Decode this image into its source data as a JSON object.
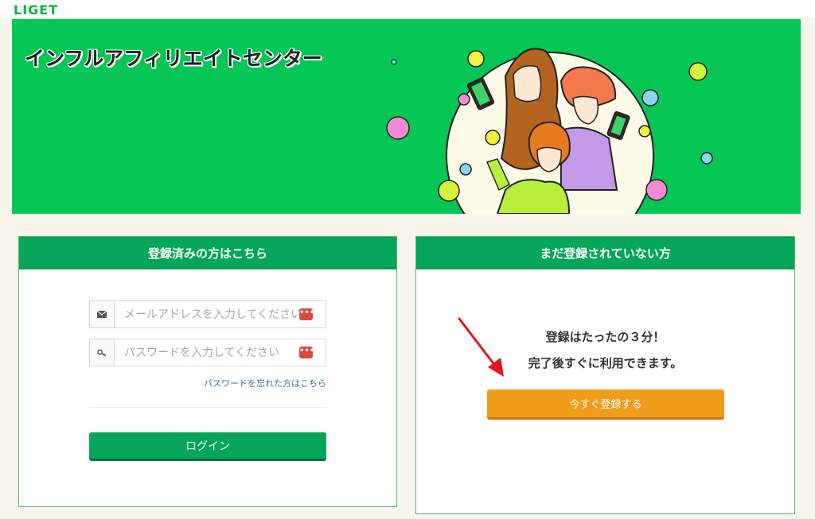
{
  "header": {
    "logo": "LIGET"
  },
  "hero": {
    "title": "インフルアフィリエイトセンター"
  },
  "login_card": {
    "title": "登録済みの方はこちら",
    "email": {
      "placeholder": "メールアドレスを入力してください",
      "value": ""
    },
    "password": {
      "placeholder": "パスワードを入力してください",
      "value": ""
    },
    "password_manager_glyph": "•••",
    "forgot_link": "パスワードを忘れた方はこちら",
    "login_button": "ログイン"
  },
  "register_card": {
    "title": "まだ登録されていない方",
    "line1": "登録はたったの３分！",
    "line2": "完了後すぐに利用できます。",
    "register_button": "今すぐ登録する"
  },
  "colors": {
    "brand_green": "#06c655",
    "header_green": "#06a65a",
    "cta_orange": "#f29c1c",
    "arrow_red": "#e8141b"
  },
  "icons": {
    "email_addon": "envelope-icon",
    "password_addon": "key-icon",
    "annotation": "red-arrow-icon"
  }
}
